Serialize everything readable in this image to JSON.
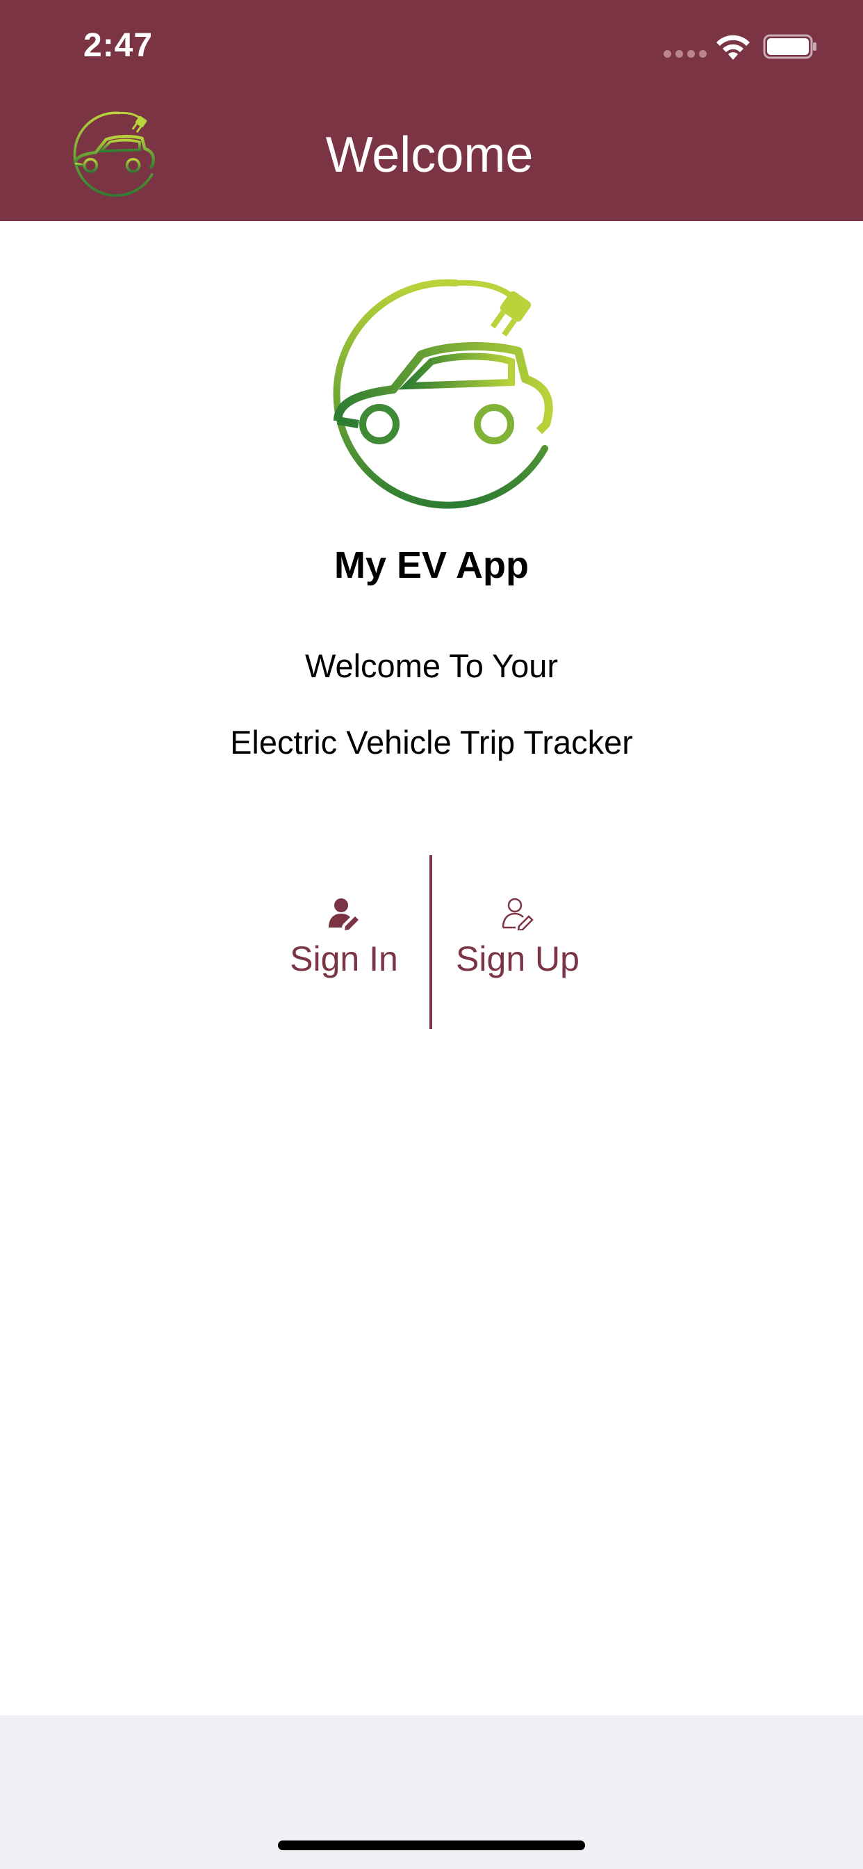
{
  "status_bar": {
    "time": "2:47",
    "icons": [
      "cellular-signal-icon",
      "wifi-icon",
      "battery-icon"
    ]
  },
  "header": {
    "title": "Welcome",
    "logo_icon": "ev-car-plug-logo-icon"
  },
  "main": {
    "logo_icon": "ev-car-plug-logo-icon",
    "app_name": "My EV App",
    "tagline_line1": "Welcome To Your",
    "tagline_line2": "Electric Vehicle Trip Tracker"
  },
  "auth": {
    "sign_in_label": "Sign In",
    "sign_in_icon": "user-edit-filled-icon",
    "sign_up_label": "Sign Up",
    "sign_up_icon": "user-edit-outline-icon"
  },
  "colors": {
    "header_bg": "#7b3444",
    "accent": "#7b3444",
    "logo_green_light": "#b9d33a",
    "logo_green_dark": "#2e7d32",
    "bottom_bar": "#efeff4"
  }
}
